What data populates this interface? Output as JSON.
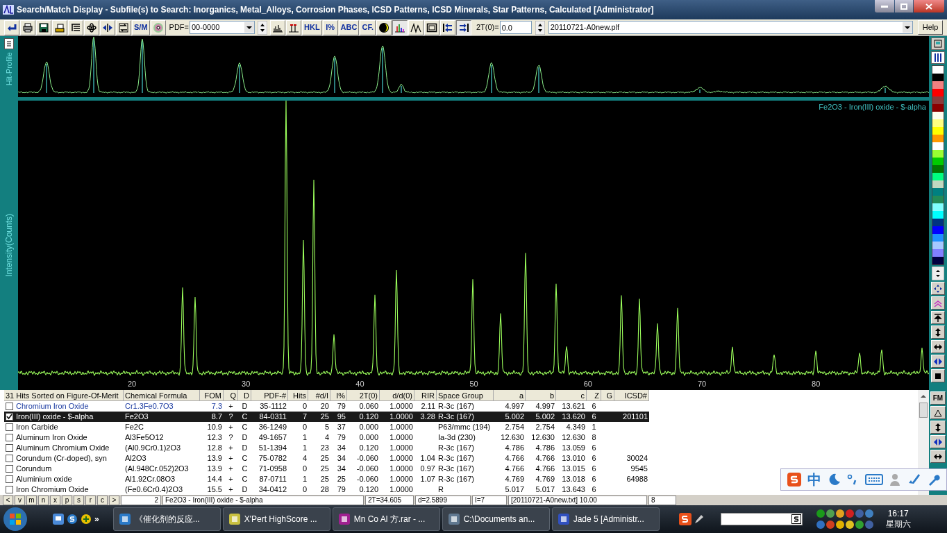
{
  "window": {
    "title": "Search/Match Display - Subfile(s) to Search: Inorganics, Metal_Alloys, Corrosion Phases, ICSD Patterns, ICSD Minerals, Star Patterns, Calculated [Administrator]"
  },
  "toolbar": {
    "buttons": [
      {
        "kind": "icon",
        "pressed": false
      },
      {
        "kind": "icon",
        "pressed": false
      },
      {
        "kind": "icon",
        "pressed": false
      },
      {
        "kind": "icon",
        "pressed": false
      },
      {
        "kind": "icon",
        "pressed": false
      },
      {
        "kind": "icon",
        "pressed": false
      },
      {
        "kind": "icon",
        "pressed": false
      },
      {
        "kind": "icon",
        "pressed": false
      },
      {
        "kind": "text",
        "label": "S/M",
        "pressed": false
      },
      {
        "kind": "icon",
        "pressed": false
      }
    ],
    "pdf_label": "PDF=",
    "pdf_value": "00-0000",
    "buttons2": [
      {
        "kind": "icon",
        "pressed": false
      },
      {
        "kind": "icon",
        "pressed": false
      },
      {
        "kind": "text",
        "label": "HKL",
        "pressed": false
      },
      {
        "kind": "text",
        "label": "I%",
        "pressed": false
      },
      {
        "kind": "text",
        "label": "ABC",
        "pressed": false
      },
      {
        "kind": "text",
        "label": "CF.",
        "pressed": false
      },
      {
        "kind": "icon",
        "pressed": false
      },
      {
        "kind": "icon",
        "pressed": true
      },
      {
        "kind": "icon",
        "pressed": false
      },
      {
        "kind": "icon",
        "pressed": false
      },
      {
        "kind": "icon",
        "pressed": false
      },
      {
        "kind": "icon",
        "pressed": true
      }
    ],
    "two_theta_label": "2T(0)=",
    "two_theta_value": "0.0",
    "file": "20110721-A0new.plf",
    "help": "Help"
  },
  "hit_profile": {
    "label": "Hit-Profile"
  },
  "chart": {
    "ylabel": "Intensity(Counts)",
    "legend": "Fe2O3 - Iron(III) oxide - $-alpha",
    "x_axis_labels": [
      "20",
      "30",
      "40",
      "50",
      "60",
      "70",
      "80"
    ]
  },
  "palette": [
    {
      "color": "#ffffff"
    },
    {
      "color": "#000000"
    },
    {
      "color": "#f08080"
    },
    {
      "color": "#ff0000"
    },
    {
      "color": "#8b3a3a"
    },
    {
      "color": "#8b0000"
    },
    {
      "color": "#fffff0"
    },
    {
      "color": "#ffff80"
    },
    {
      "color": "#ffff00"
    },
    {
      "color": "#ff9900"
    },
    {
      "color": "#ffffff"
    },
    {
      "color": "#99ff33"
    },
    {
      "color": "#00cc00"
    },
    {
      "color": "#007700"
    },
    {
      "color": "#00ff80"
    },
    {
      "color": "#c0d8c0"
    },
    {
      "color": "#008080"
    },
    {
      "color": "#228b57"
    },
    {
      "color": "#80ffff"
    },
    {
      "color": "#00ffff"
    },
    {
      "color": "#003380"
    },
    {
      "color": "#0000ff"
    },
    {
      "color": "#1e90ff"
    },
    {
      "color": "#a6c8ff"
    },
    {
      "color": "#8080ff"
    },
    {
      "color": "#000040"
    }
  ],
  "table": {
    "columns": [
      "31 Hits Sorted on Figure-Of-Merit",
      "Chemical Formula",
      "FOM",
      "Q",
      "D",
      "PDF-#",
      "Hits",
      "#d/I",
      "I%",
      "2T(0)",
      "d/d(0)",
      "RIR",
      "Space Group",
      "a",
      "b",
      "c",
      "Z",
      "G",
      "ICSD#"
    ],
    "rows": [
      {
        "checked": false,
        "selected": false,
        "focused": true,
        "cells": [
          "Chromium Iron Oxide",
          "Cr1.3Fe0.7O3",
          "7.3",
          "+",
          "D",
          "35-1112",
          "0",
          "20",
          "79",
          "0.060",
          "1.0000",
          "2.11",
          "R-3c (167)",
          "4.997",
          "4.997",
          "13.621",
          "6"
        ]
      },
      {
        "checked": true,
        "selected": true,
        "focused": false,
        "cells": [
          "Iron(III) oxide - $-alpha",
          "Fe2O3",
          "8.7",
          "?",
          "C",
          "84-0311",
          "7",
          "25",
          "95",
          "0.120",
          "1.0000",
          "3.28",
          "R-3c (167)",
          "5.002",
          "5.002",
          "13.620",
          "6",
          null,
          "201101"
        ]
      },
      {
        "checked": false,
        "selected": false,
        "focused": false,
        "cells": [
          "Iron Carbide",
          "Fe2C",
          "10.9",
          "+",
          "C",
          "36-1249",
          "0",
          "5",
          "37",
          "0.000",
          "1.0000",
          null,
          "P63/mmc (194)",
          "2.754",
          "2.754",
          "4.349",
          "1"
        ]
      },
      {
        "checked": false,
        "selected": false,
        "focused": false,
        "cells": [
          "Aluminum Iron Oxide",
          "Al3Fe5O12",
          "12.3",
          "?",
          "D",
          "49-1657",
          "1",
          "4",
          "79",
          "0.000",
          "1.0000",
          null,
          "Ia-3d (230)",
          "12.630",
          "12.630",
          "12.630",
          "8"
        ]
      },
      {
        "checked": false,
        "selected": false,
        "focused": false,
        "cells": [
          "Aluminum Chromium Oxide",
          "(Al0.9Cr0.1)2O3",
          "12.8",
          "+",
          "D",
          "51-1394",
          "1",
          "23",
          "34",
          "0.120",
          "1.0000",
          null,
          "R-3c (167)",
          "4.786",
          "4.786",
          "13.059",
          "6"
        ]
      },
      {
        "checked": false,
        "selected": false,
        "focused": false,
        "cells": [
          "Corundum (Cr-doped), syn",
          "Al2O3",
          "13.9",
          "+",
          "C",
          "75-0782",
          "4",
          "25",
          "34",
          "-0.060",
          "1.0000",
          "1.04",
          "R-3c (167)",
          "4.766",
          "4.766",
          "13.010",
          "6",
          null,
          "30024"
        ]
      },
      {
        "checked": false,
        "selected": false,
        "focused": false,
        "cells": [
          "Corundum",
          "(Al.948Cr.052)2O3",
          "13.9",
          "+",
          "C",
          "71-0958",
          "0",
          "25",
          "34",
          "-0.060",
          "1.0000",
          "0.97",
          "R-3c (167)",
          "4.766",
          "4.766",
          "13.015",
          "6",
          null,
          "9545"
        ]
      },
      {
        "checked": false,
        "selected": false,
        "focused": false,
        "cells": [
          "Aluminium oxide",
          "Al1.92Cr.08O3",
          "14.4",
          "+",
          "C",
          "87-0711",
          "1",
          "25",
          "25",
          "-0.060",
          "1.0000",
          "1.07",
          "R-3c (167)",
          "4.769",
          "4.769",
          "13.018",
          "6",
          null,
          "64988"
        ]
      },
      {
        "checked": false,
        "selected": false,
        "focused": false,
        "cells": [
          "Iron Chromium Oxide",
          "(Fe0.6Cr0.4)2O3",
          "15.5",
          "+",
          "D",
          "34-0412",
          "0",
          "28",
          "79",
          "0.120",
          "1.0000",
          null,
          "R",
          "5.017",
          "5.017",
          "13.643",
          "6"
        ]
      }
    ]
  },
  "side_buttons": [
    {
      "label": "FM"
    }
  ],
  "status_bar": {
    "tabs": [
      "<",
      "v",
      "m",
      "n",
      "x",
      "p",
      "s",
      "r",
      "c",
      ">"
    ],
    "fields": [
      "2",
      "Fe2O3 - Iron(III) oxide - $-alpha",
      "2T=34.605",
      "d=2.5899",
      "I=7",
      "[20110721-A0new.txt] 10.00",
      "8"
    ]
  },
  "ime": {
    "label": "中"
  },
  "taskbar": {
    "tasks": [
      "《催化剂的反应...",
      "X'Pert HighScore ...",
      "Mn Co Al 方.rar - ...",
      "C:\\Documents an...",
      "Jade 5 [Administr..."
    ],
    "clock": "16:17",
    "day": "星期六",
    "more": "»"
  }
}
